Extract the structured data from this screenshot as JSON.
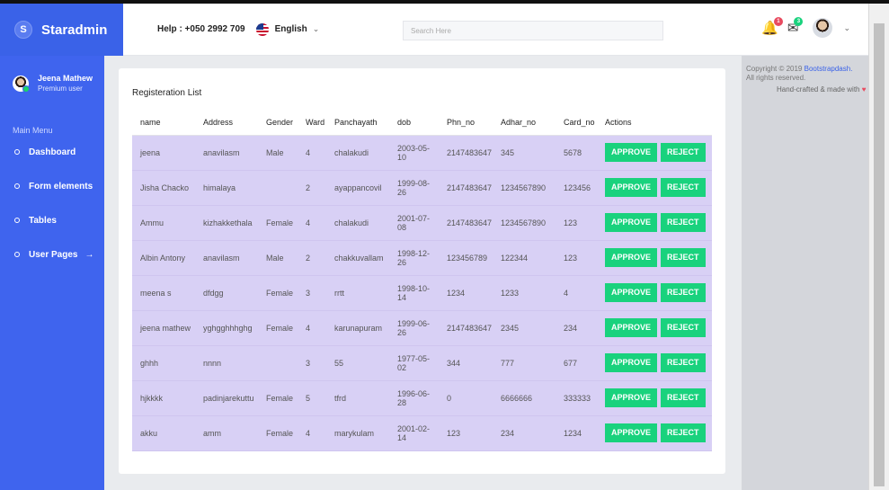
{
  "brand": {
    "badge": "S",
    "name": "Staradmin"
  },
  "navbar": {
    "help": "Help : +050 2992 709",
    "language": "English",
    "search_placeholder": "Search Here",
    "bell_badge": "1",
    "mail_badge": "3"
  },
  "sidebar": {
    "user_name": "Jeena Mathew",
    "user_role": "Premium user",
    "menu_heading": "Main Menu",
    "items": [
      {
        "label": "Dashboard"
      },
      {
        "label": "Form elements"
      },
      {
        "label": "Tables"
      },
      {
        "label": "User Pages",
        "arrow": "→"
      }
    ]
  },
  "main": {
    "card_title": "Registeration List",
    "columns": [
      "name",
      "Address",
      "Gender",
      "Ward",
      "Panchayath",
      "dob",
      "Phn_no",
      "Adhar_no",
      "Card_no",
      "Actions"
    ],
    "approve_label": "APPROVE",
    "reject_label": "REJECT",
    "rows": [
      [
        "jeena",
        "anavilasm",
        "Male",
        "4",
        "chalakudi",
        "2003-05-10",
        "2147483647",
        "345",
        "5678"
      ],
      [
        "Jisha Chacko",
        "himalaya",
        "",
        "2",
        "ayappancovil",
        "1999-08-26",
        "2147483647",
        "1234567890",
        "123456"
      ],
      [
        "Ammu",
        "kizhakkethala",
        "Female",
        "4",
        "chalakudi",
        "2001-07-08",
        "2147483647",
        "1234567890",
        "123"
      ],
      [
        "Albin Antony",
        "anavilasm",
        "Male",
        "2",
        "chakkuvallam",
        "1998-12-26",
        "123456789",
        "122344",
        "123"
      ],
      [
        "meena s",
        "dfdgg",
        "Female",
        "3",
        "rrtt",
        "1998-10-14",
        "1234",
        "1233",
        "4"
      ],
      [
        "jeena mathew",
        "yghgghhhghg",
        "Female",
        "4",
        "karunapuram",
        "1999-06-26",
        "2147483647",
        "2345",
        "234"
      ],
      [
        "ghhh",
        "nnnn",
        "",
        "3",
        "55",
        "1977-05-02",
        "344",
        "777",
        "677"
      ],
      [
        "hjkkkk",
        "padinjarekuttu",
        "Female",
        "5",
        "tfrd",
        "1996-06-28",
        "0",
        "6666666",
        "333333"
      ],
      [
        "akku",
        "amm",
        "Female",
        "4",
        "marykulam",
        "2001-02-14",
        "123",
        "234",
        "1234"
      ]
    ]
  },
  "right_panel": {
    "copyright": "Copyright © 2019",
    "link": "Bootstrapdash.",
    "rights": "All rights reserved.",
    "crafted": "Hand-crafted & made with"
  }
}
